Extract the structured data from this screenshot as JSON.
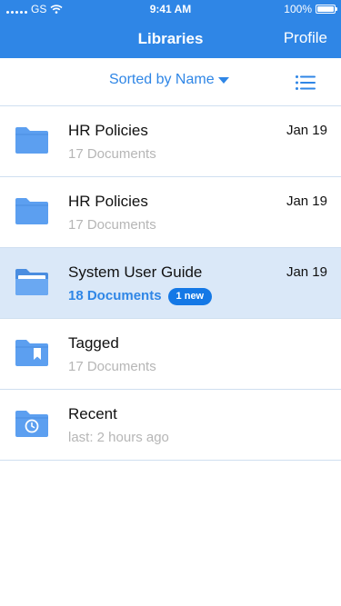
{
  "status_bar": {
    "carrier": "GS",
    "time": "9:41 AM",
    "battery": "100%"
  },
  "nav": {
    "title": "Libraries",
    "profile_label": "Profile"
  },
  "toolbar": {
    "sort_label": "Sorted by Name"
  },
  "colors": {
    "accent": "#2f86e6",
    "folder": "#5c9ff0",
    "selected_row": "#dae8f8",
    "badge": "#1478e6"
  },
  "rows": [
    {
      "icon": "folder-icon",
      "title": "HR Policies",
      "date": "Jan 19",
      "subtitle": "17 Documents"
    },
    {
      "icon": "folder-icon",
      "title": "HR Policies",
      "date": "Jan 19",
      "subtitle": "17 Documents"
    },
    {
      "icon": "folder-open-icon",
      "title": "System User Guide",
      "date": "Jan 19",
      "subtitle": "18 Documents",
      "badge": "1 new",
      "selected": true
    },
    {
      "icon": "folder-bookmark-icon",
      "title": "Tagged",
      "subtitle": "17 Documents"
    },
    {
      "icon": "folder-clock-icon",
      "title": "Recent",
      "subtitle": "last: 2 hours ago"
    }
  ]
}
